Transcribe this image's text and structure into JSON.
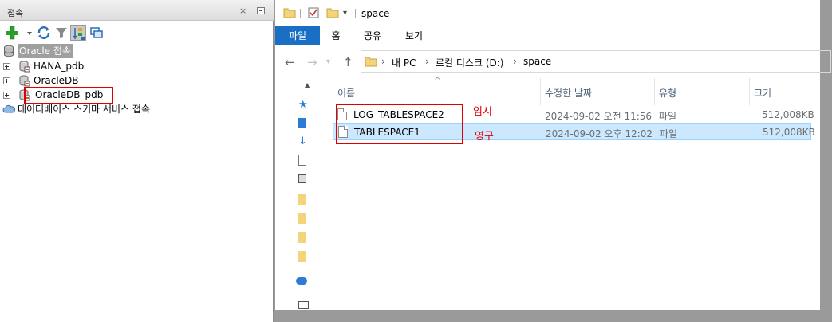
{
  "left_panel": {
    "title": "접속",
    "close_glyph": "×",
    "toolbar": {
      "icons": [
        "add-connection-icon",
        "dropdown-arrow-icon",
        "refresh-icon",
        "filter-icon",
        "schema-browser-icon",
        "manage-cloud-icon"
      ]
    },
    "tree": {
      "root_label": "Oracle 접속",
      "items": [
        {
          "label": "HANA_pdb"
        },
        {
          "label": "OracleDB"
        },
        {
          "label": "OracleDB_pdb"
        }
      ],
      "cloud_label": "데이터베이스 스키마 서비스 접속"
    }
  },
  "explorer": {
    "title": "space",
    "ribbon_tabs": [
      "파일",
      "홈",
      "공유",
      "보기"
    ],
    "breadcrumb": [
      "내 PC",
      "로컬 디스크 (D:)",
      "space"
    ],
    "columns": {
      "name": "이름",
      "modified": "수정한 날짜",
      "type": "유형",
      "size": "크기"
    },
    "files": [
      {
        "name": "LOG_TABLESPACE2",
        "modified": "2024-09-02 오전 11:56",
        "type": "파일",
        "size": "512,008KB",
        "selected": false
      },
      {
        "name": "TABLESPACE1",
        "modified": "2024-09-02 오후 12:02",
        "type": "파일",
        "size": "512,008KB",
        "selected": true
      }
    ],
    "annotations": {
      "temp": "임시",
      "permanent": "영구"
    }
  },
  "colors": {
    "file_tab": "#1a6fc4",
    "annotation_red": "#e00000",
    "selected_row": "#cce8ff",
    "column_header_text": "#4c607a"
  }
}
